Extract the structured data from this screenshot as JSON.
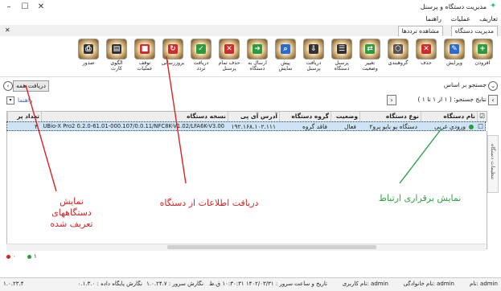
{
  "window": {
    "title": "مدیریت دستگاه و پرسنل"
  },
  "menu": {
    "items": [
      "تعاریف",
      "عملیات",
      "راهنما"
    ]
  },
  "tabs": [
    {
      "label": "مدیریت دستگاه"
    },
    {
      "label": "مشاهده ترددها"
    }
  ],
  "ribbon": {
    "tools": [
      {
        "label": "افزودن",
        "icon": "add-icon",
        "color": "#2e9a3e",
        "glyph": "+"
      },
      {
        "label": "ویرایش",
        "icon": "edit-icon",
        "color": "#2a6bd1",
        "glyph": "✎"
      },
      {
        "label": "حذف",
        "icon": "delete-icon",
        "color": "#d12a2a",
        "glyph": "✕"
      },
      {
        "label": "گروهبندی",
        "icon": "group-icon",
        "color": "#555555",
        "glyph": "⬡"
      },
      {
        "label": "تغییر وضعیت",
        "icon": "toggle-status-icon",
        "color": "#2e9a3e",
        "glyph": "⇄"
      },
      {
        "label": "پرسنل دستگاه",
        "icon": "personnel-icon",
        "color": "#333333",
        "glyph": "☰"
      },
      {
        "label": "دریافت پرسنل",
        "icon": "download-personnel-icon",
        "color": "#333333",
        "glyph": "⇩"
      },
      {
        "label": "پیش نمایش",
        "icon": "preview-icon",
        "color": "#2a6bd1",
        "glyph": "⌕"
      },
      {
        "label": "ارسال به دستگاه",
        "icon": "send-to-device-icon",
        "color": "#2e9a3e",
        "glyph": "➜"
      },
      {
        "label": "حذف تمام پرسنل",
        "icon": "delete-all-personnel-icon",
        "color": "#d12a2a",
        "glyph": "✕"
      },
      {
        "label": "دریافت تردد",
        "icon": "receive-traffic-icon",
        "color": "#2e9a3e",
        "glyph": "✓"
      },
      {
        "label": "بروزرسانی",
        "icon": "refresh-icon",
        "color": "#d12a2a",
        "glyph": "↻"
      },
      {
        "label": "توقف عملیات",
        "icon": "stop-icon",
        "color": "#d12a2a",
        "glyph": "■"
      },
      {
        "label": "الگوی کارت",
        "icon": "card-template-icon",
        "color": "#333333",
        "glyph": "▤"
      },
      {
        "label": "صدور",
        "icon": "issue-icon",
        "color": "#333333",
        "glyph": "⎙"
      }
    ]
  },
  "search": {
    "label": "جستجو بر اساس",
    "receive_all": "دریافت همه"
  },
  "filter": {
    "result": "نتایج جستجو: ( ۱ از ۱ تا ۱ )",
    "help": "راهنما"
  },
  "grid": {
    "headers": [
      "نام دستگاه",
      "نوع دستگاه",
      "وضعیت",
      "گروه دستگاه",
      "آدرس آی پی",
      "نسخه دستگاه",
      "تعداد پر"
    ],
    "rows": [
      {
        "name": "ورودی غربی",
        "type": "دستگاه یو بایو پرو۲",
        "status": "فعال",
        "group": "فاقد گروه",
        "ip": "۱۹۲.۱۶۸.۱۰۲.۱۱۱",
        "version": "UBio-X Pro2 0.2.0-61.01-000.107/0.0.11/NFC8K-V1.02/LFA6K-V3.00",
        "count": "۳"
      }
    ]
  },
  "side_tab": {
    "label": "تنظیمات دستگاه"
  },
  "annotations": [
    {
      "text": "نمایش برقراری ارتباط",
      "color": "#2ea043"
    },
    {
      "text": "دریافت اطلاعات از دستگاه",
      "color": "#d22"
    },
    {
      "text": "نمایش دستگاههای تعریف شده",
      "color": "#d22"
    }
  ],
  "status_counts": {
    "red": "۰",
    "green": "۱"
  },
  "statusbar": {
    "name": "نام: admin",
    "family": "نام خانوادگی: admin",
    "username": "نام کاربری: admin",
    "datetime": "تاریخ و ساعت سرور : ۱۴۰۲/۰۳/۳۱ ۱۰:۳۰:۳۱ ق.ظ",
    "server_version": "نگارش سرور : ۱.۰.۲۴.۷",
    "db_version": "نگارش پایگاه داده : ۰.۱.۳.۰",
    "client_version": "۱.۰.۲۳.۴"
  }
}
